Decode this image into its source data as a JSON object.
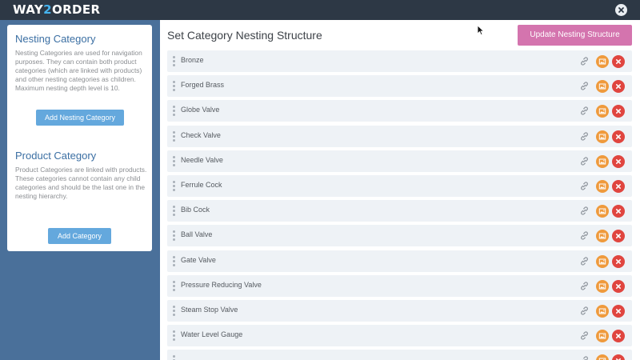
{
  "app": {
    "logo_prefix": "WAY",
    "logo_accent": "2",
    "logo_suffix": "ORDER"
  },
  "sidebar": {
    "nesting_card": {
      "title": "Nesting Category",
      "description": "Nesting Categories are used for navigation purposes. They can contain both product categories (which are linked with products) and other nesting categories as children. Maximum nesting depth level is 10.",
      "button_label": "Add Nesting Category"
    },
    "product_card": {
      "title": "Product Category",
      "description": "Product Categories are linked with products. These categories cannot contain any child categories and should be the last one in the nesting hierarchy.",
      "button_label": "Add Category"
    }
  },
  "main": {
    "title": "Set Category Nesting Structure",
    "update_button_label": "Update Nesting Structure",
    "categories": [
      {
        "name": "Bronze"
      },
      {
        "name": "Forged Brass"
      },
      {
        "name": "Globe Valve"
      },
      {
        "name": "Check Valve"
      },
      {
        "name": "Needle Valve"
      },
      {
        "name": "Ferrule Cock"
      },
      {
        "name": "Bib Cock"
      },
      {
        "name": "Ball Valve"
      },
      {
        "name": "Gate Valve"
      },
      {
        "name": "Pressure Reducing Valve"
      },
      {
        "name": "Steam Stop Valve"
      },
      {
        "name": "Water Level Gauge"
      },
      {
        "name": ""
      }
    ]
  },
  "icons": {
    "close": "close-icon",
    "drag": "drag-handle-icon",
    "link": "link-icon",
    "image": "image-icon",
    "delete": "delete-icon"
  },
  "colors": {
    "topbar": "#2d3845",
    "logo_accent": "#46b4ef",
    "sidebar": "#4a709a",
    "card_title": "#3b6fa3",
    "sidebar_button": "#64a8dd",
    "update_button": "#d474ae",
    "row_background": "#eef2f6",
    "image_button": "#ef9a3c",
    "delete_button": "#e0453f"
  }
}
